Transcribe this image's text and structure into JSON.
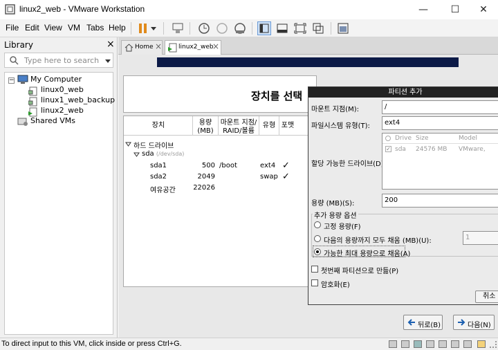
{
  "window": {
    "title": "linux2_web - VMware Workstation",
    "min": "—",
    "max": "☐",
    "close": "✕"
  },
  "menu": {
    "file": "File",
    "edit": "Edit",
    "view": "View",
    "vm": "VM",
    "tabs": "Tabs",
    "help": "Help"
  },
  "library": {
    "title": "Library",
    "close": "×",
    "search_placeholder": "Type here to search",
    "tree": {
      "root": "My Computer",
      "vms": [
        "linux0_web",
        "linux1_web_backup",
        "linux2_web"
      ],
      "shared": "Shared VMs"
    }
  },
  "tabs": {
    "home": "Home",
    "vm": "linux2_web",
    "close": "×"
  },
  "installer": {
    "heading": "장치를 선택",
    "columns": {
      "device": "장치",
      "size": "용량\n(MB)",
      "mount": "마운트 지점/\nRAID/볼륨",
      "type": "유형",
      "format": "포맷"
    },
    "tree": {
      "hdd": "하드 드라이브",
      "sda": "sda",
      "sda_path": "(/dev/sda)",
      "rows": [
        {
          "device": "sda1",
          "size": "500",
          "mount": "/boot",
          "type": "ext4",
          "format": "✓"
        },
        {
          "device": "sda2",
          "size": "2049",
          "mount": "",
          "type": "swap",
          "format": "✓"
        },
        {
          "device": "여유공간",
          "size": "22026",
          "mount": "",
          "type": "",
          "format": ""
        }
      ]
    },
    "back": "뒤로(B)",
    "next": "다음(N)"
  },
  "dialog": {
    "title": "파티션 추가",
    "mount_label": "마운트 지점(M):",
    "mount_value": "/",
    "fs_label": "파일시스템 유형(T):",
    "fs_value": "ext4",
    "drives_label": "할당 가능한 드라이브(D):",
    "drive_cols": {
      "drive": "Drive",
      "size": "Size",
      "model": "Model"
    },
    "drive_row": {
      "drive": "sda",
      "size": "24576 MB",
      "model": "VMware,"
    },
    "size_label": "용량 (MB)(S):",
    "size_value": "200",
    "options_title": "추가 용량 옵션",
    "opt_fixed": "고정 용량(F)",
    "opt_fill_upto": "다음의 용량까지 모두 채움 (MB)(U):",
    "opt_fill_upto_value": "1",
    "opt_fill_max": "가능한 최대 용량으로 채움(A)",
    "primary": "첫번째 파티션으로 만듦(P)",
    "encrypt": "암호화(E)",
    "cancel": "취소"
  },
  "status": {
    "text": "To direct input to this VM, click inside or press Ctrl+G."
  }
}
